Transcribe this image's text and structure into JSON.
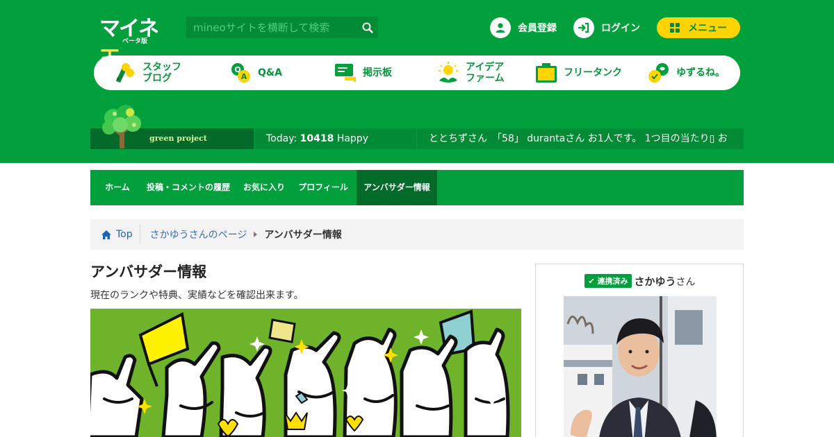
{
  "header": {
    "logo": "マイネ王",
    "logo_sub": "ベータ版",
    "search_placeholder": "mineoサイトを横断して検索",
    "register_label": "会員登録",
    "login_label": "ログイン",
    "menu_label": "メニュー"
  },
  "nav": [
    {
      "label": "スタッフ\nブログ",
      "icon": "staff-blog-icon"
    },
    {
      "label": "Q&A",
      "icon": "qa-icon"
    },
    {
      "label": "掲示板",
      "icon": "bbs-icon"
    },
    {
      "label": "アイデア\nファーム",
      "icon": "idea-icon"
    },
    {
      "label": "フリータンク",
      "icon": "tank-icon"
    },
    {
      "label": "ゆずるね。",
      "icon": "yuzurune-icon"
    }
  ],
  "green_project": {
    "label": "green project",
    "today_prefix": "Today:",
    "today_count": "10418",
    "today_suffix": "Happy",
    "ticker": "ととちずさん　「58」 durantaさん お1人です。 1つ目の当たり▯ お"
  },
  "subnav": [
    {
      "label": "ホーム",
      "active": false
    },
    {
      "label": "投稿・コメントの履歴",
      "active": false
    },
    {
      "label": "お気に入り",
      "active": false
    },
    {
      "label": "プロフィール",
      "active": false
    },
    {
      "label": "アンバサダー情報",
      "active": true
    }
  ],
  "breadcrumb": {
    "home": "Top",
    "parent": "さかゆうさんのページ",
    "current": "アンバサダー情報"
  },
  "main": {
    "title": "アンバサダー情報",
    "description": "現在のランクや特典、実績などを確認出来ます。"
  },
  "profile": {
    "badge": "連携済み",
    "name": "さかゆう",
    "honorific": "さん"
  },
  "colors": {
    "brand_green": "#02a03c",
    "dark_green": "#026b29",
    "accent_yellow": "#ffd400"
  }
}
